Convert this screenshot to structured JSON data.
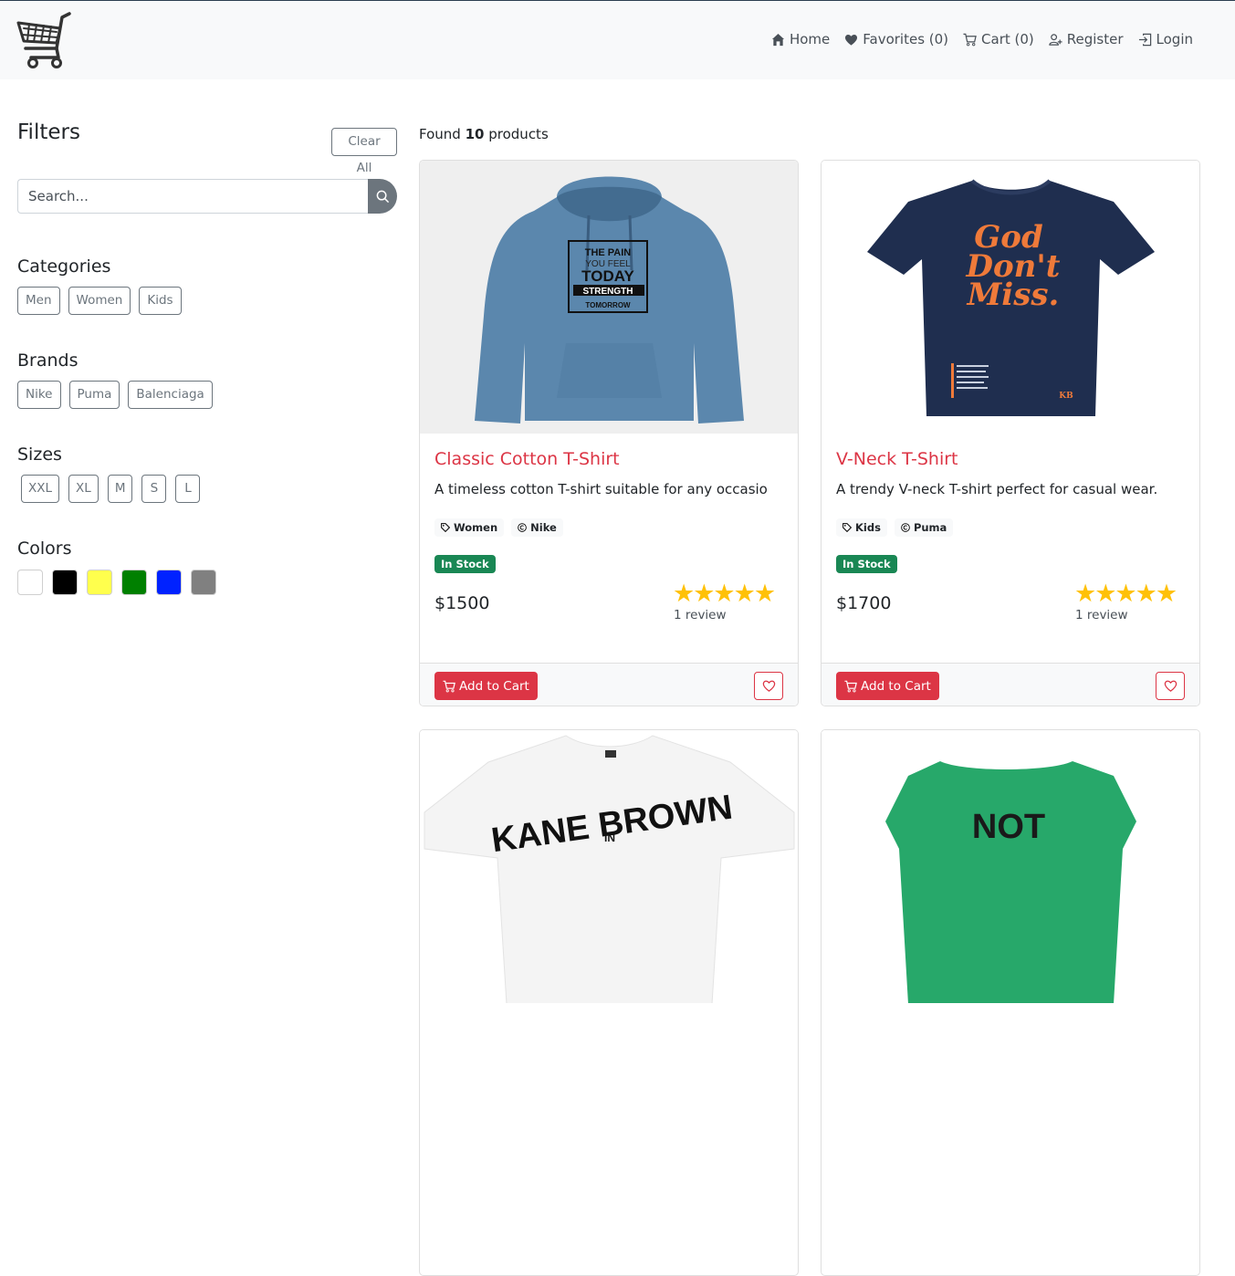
{
  "nav": {
    "links": [
      {
        "label": "Home",
        "icon": "home-icon"
      },
      {
        "label": "Favorites (0)",
        "icon": "heart-icon"
      },
      {
        "label": "Cart (0)",
        "icon": "cart-icon"
      },
      {
        "label": "Register",
        "icon": "user-plus-icon"
      },
      {
        "label": "Login",
        "icon": "login-icon"
      }
    ]
  },
  "filters": {
    "title": "Filters",
    "clear_label": "Clear All",
    "search_placeholder": "Search...",
    "categories_title": "Categories",
    "categories": [
      "Men",
      "Women",
      "Kids"
    ],
    "brands_title": "Brands",
    "brands": [
      "Nike",
      "Puma",
      "Balenciaga"
    ],
    "sizes_title": "Sizes",
    "sizes": [
      "XXL",
      "XL",
      "M",
      "S",
      "L"
    ],
    "colors_title": "Colors",
    "colors": [
      "#ffffff",
      "#000000",
      "#ffff4d",
      "#008000",
      "#0022ff",
      "#808080"
    ]
  },
  "results": {
    "prefix": "Found",
    "count": "10",
    "suffix": "products"
  },
  "products": [
    {
      "title": "Classic Cotton T-Shirt",
      "description": "A timeless cotton T-shirt suitable for any occasio",
      "category": "Women",
      "brand": "Nike",
      "stock": "In Stock",
      "price": "$1500",
      "stars": "★★★★★",
      "rating": 5,
      "reviews": "1 review",
      "add_label": "Add to Cart",
      "image_text": [
        "THE PAIN",
        "YOU FEEL",
        "TODAY",
        "STRENGTH",
        "TOMORROW"
      ]
    },
    {
      "title": "V-Neck T-Shirt",
      "description": "A trendy V-neck T-shirt perfect for casual wear.",
      "category": "Kids",
      "brand": "Puma",
      "stock": "In Stock",
      "price": "$1700",
      "stars": "★★★★★",
      "rating": 5,
      "reviews": "1 review",
      "add_label": "Add to Cart",
      "image_text": [
        "God",
        "Don't",
        "Miss.",
        "KB"
      ]
    },
    {
      "image_text": [
        "KANE BROWN",
        "IN"
      ]
    },
    {
      "image_text": [
        "NOT"
      ]
    }
  ],
  "colors": {
    "accent": "#dc3545",
    "success": "#198754",
    "secondary": "#6c757d",
    "star": "#ffc107"
  }
}
